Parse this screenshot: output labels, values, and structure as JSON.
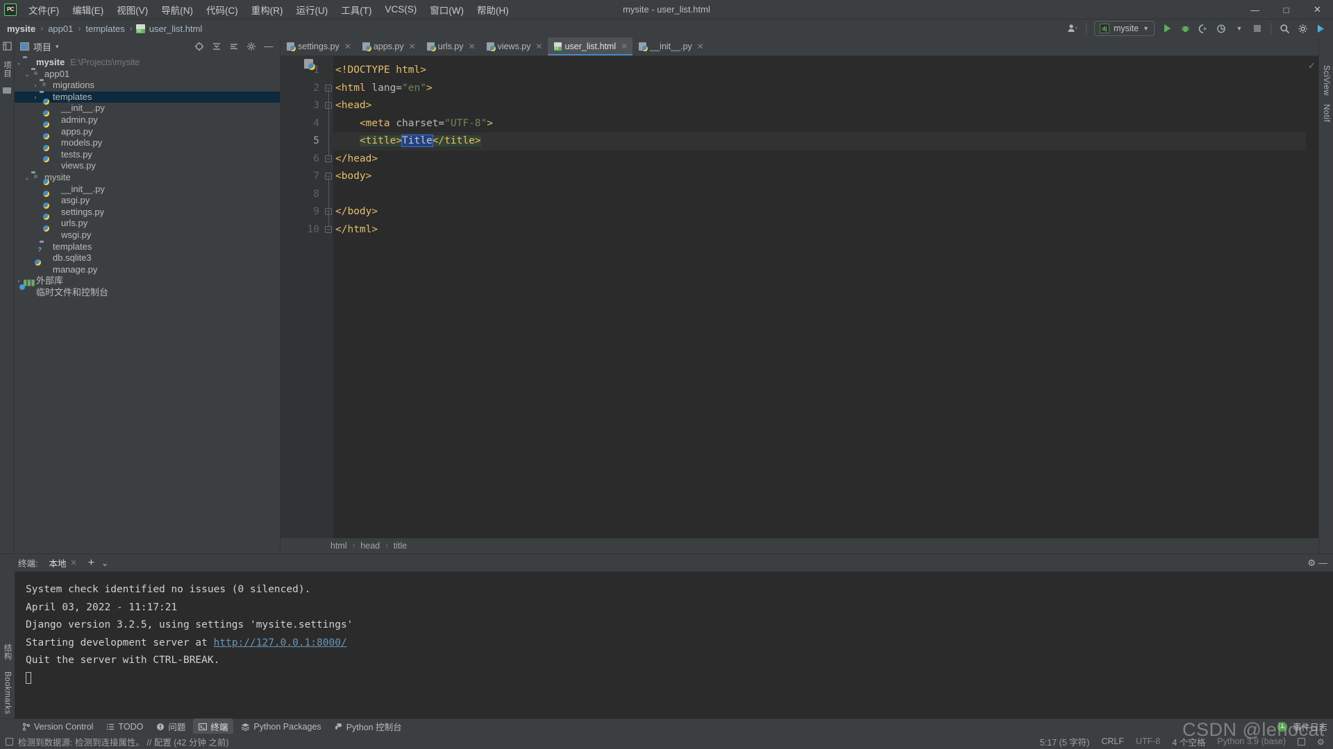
{
  "window": {
    "title": "mysite - user_list.html",
    "minimize": "—",
    "maximize": "□",
    "close": "✕",
    "logo": "PC"
  },
  "menu": {
    "items": [
      {
        "label": "文件(F)"
      },
      {
        "label": "编辑(E)"
      },
      {
        "label": "视图(V)"
      },
      {
        "label": "导航(N)"
      },
      {
        "label": "代码(C)"
      },
      {
        "label": "重构(R)"
      },
      {
        "label": "运行(U)"
      },
      {
        "label": "工具(T)"
      },
      {
        "label": "VCS(S)"
      },
      {
        "label": "窗口(W)"
      },
      {
        "label": "帮助(H)"
      }
    ]
  },
  "breadcrumb": {
    "items": [
      "mysite",
      "app01",
      "templates",
      "user_list.html"
    ],
    "separator": "›"
  },
  "toolbar": {
    "run_config": "mysite",
    "dj_badge": "dj",
    "run_title": "运行",
    "debug_title": "调试",
    "coverage_title": "覆盖率",
    "profile_title": "性能分析",
    "stop_title": "停止",
    "search_title": "搜索",
    "settings_title": "设置",
    "updates_title": "更新"
  },
  "project_panel": {
    "title": "项目",
    "caret": "▾",
    "tree": [
      {
        "depth": 0,
        "arrow": "⌄",
        "icon": "folder",
        "label": "mysite",
        "bold": true,
        "path": "E:\\Projects\\mysite",
        "selected": false
      },
      {
        "depth": 1,
        "arrow": "⌄",
        "icon": "folder-module",
        "label": "app01",
        "bold": false,
        "path": "",
        "selected": false
      },
      {
        "depth": 2,
        "arrow": "›",
        "icon": "folder-module",
        "label": "migrations",
        "bold": false,
        "path": "",
        "selected": false
      },
      {
        "depth": 2,
        "arrow": "›",
        "icon": "folder",
        "label": "templates",
        "bold": false,
        "path": "",
        "selected": true
      },
      {
        "depth": 3,
        "arrow": "",
        "icon": "python",
        "label": "__init__.py",
        "bold": false,
        "path": "",
        "selected": false
      },
      {
        "depth": 3,
        "arrow": "",
        "icon": "python",
        "label": "admin.py",
        "bold": false,
        "path": "",
        "selected": false
      },
      {
        "depth": 3,
        "arrow": "",
        "icon": "python",
        "label": "apps.py",
        "bold": false,
        "path": "",
        "selected": false
      },
      {
        "depth": 3,
        "arrow": "",
        "icon": "python",
        "label": "models.py",
        "bold": false,
        "path": "",
        "selected": false
      },
      {
        "depth": 3,
        "arrow": "",
        "icon": "python",
        "label": "tests.py",
        "bold": false,
        "path": "",
        "selected": false
      },
      {
        "depth": 3,
        "arrow": "",
        "icon": "python",
        "label": "views.py",
        "bold": false,
        "path": "",
        "selected": false
      },
      {
        "depth": 1,
        "arrow": "⌄",
        "icon": "folder-module",
        "label": "mysite",
        "bold": false,
        "path": "",
        "selected": false
      },
      {
        "depth": 3,
        "arrow": "",
        "icon": "python",
        "label": "__init__.py",
        "bold": false,
        "path": "",
        "selected": false
      },
      {
        "depth": 3,
        "arrow": "",
        "icon": "python",
        "label": "asgi.py",
        "bold": false,
        "path": "",
        "selected": false
      },
      {
        "depth": 3,
        "arrow": "",
        "icon": "python",
        "label": "settings.py",
        "bold": false,
        "path": "",
        "selected": false
      },
      {
        "depth": 3,
        "arrow": "",
        "icon": "python",
        "label": "urls.py",
        "bold": false,
        "path": "",
        "selected": false
      },
      {
        "depth": 3,
        "arrow": "",
        "icon": "python",
        "label": "wsgi.py",
        "bold": false,
        "path": "",
        "selected": false
      },
      {
        "depth": 2,
        "arrow": "",
        "icon": "folder-purple",
        "label": "templates",
        "bold": false,
        "path": "",
        "selected": false
      },
      {
        "depth": 2,
        "arrow": "",
        "icon": "db",
        "label": "db.sqlite3",
        "bold": false,
        "path": "",
        "selected": false
      },
      {
        "depth": 2,
        "arrow": "",
        "icon": "python",
        "label": "manage.py",
        "bold": false,
        "path": "",
        "selected": false
      },
      {
        "depth": 0,
        "arrow": "›",
        "icon": "library",
        "label": "外部库",
        "bold": false,
        "path": "",
        "selected": false
      },
      {
        "depth": 0,
        "arrow": "",
        "icon": "scratch",
        "label": "临时文件和控制台",
        "bold": false,
        "path": "",
        "selected": false
      }
    ]
  },
  "left_strip": {
    "items": [
      "项目",
      "收藏"
    ]
  },
  "right_strip": {
    "items": [
      "SciView",
      "Notif"
    ]
  },
  "editor": {
    "tabs": [
      {
        "label": "settings.py",
        "icon": "python",
        "active": false
      },
      {
        "label": "apps.py",
        "icon": "python",
        "active": false
      },
      {
        "label": "urls.py",
        "icon": "python",
        "active": false
      },
      {
        "label": "views.py",
        "icon": "python",
        "active": false
      },
      {
        "label": "user_list.html",
        "icon": "html",
        "active": true
      },
      {
        "label": "__init__.py",
        "icon": "python",
        "active": false
      }
    ],
    "close_glyph": "✕",
    "lines": [
      {
        "num": "1",
        "fold": "",
        "current": false,
        "tokens": [
          {
            "t": "<!DOCTYPE html>",
            "c": "tg"
          }
        ]
      },
      {
        "num": "2",
        "fold": "minus-down",
        "current": false,
        "tokens": [
          {
            "t": "<html ",
            "c": "tg"
          },
          {
            "t": "lang=",
            "c": "at"
          },
          {
            "t": "\"en\"",
            "c": "vl"
          },
          {
            "t": ">",
            "c": "tg"
          }
        ]
      },
      {
        "num": "3",
        "fold": "minus-down",
        "current": false,
        "tokens": [
          {
            "t": "<head>",
            "c": "tg"
          }
        ]
      },
      {
        "num": "4",
        "fold": "",
        "current": false,
        "tokens": [
          {
            "t": "    <meta ",
            "c": "tg"
          },
          {
            "t": "charset=",
            "c": "at"
          },
          {
            "t": "\"UTF-8\"",
            "c": "vl"
          },
          {
            "t": ">",
            "c": "tg"
          }
        ]
      },
      {
        "num": "5",
        "fold": "",
        "current": true,
        "tokens": [
          {
            "t": "    ",
            "c": "pl"
          },
          {
            "t": "<title>",
            "c": "tg hl"
          },
          {
            "t": "Title",
            "c": "selbox"
          },
          {
            "t": "</title>",
            "c": "tg hl"
          }
        ]
      },
      {
        "num": "6",
        "fold": "minus-up",
        "current": false,
        "tokens": [
          {
            "t": "</head>",
            "c": "tg"
          }
        ]
      },
      {
        "num": "7",
        "fold": "minus-down",
        "current": false,
        "tokens": [
          {
            "t": "<body>",
            "c": "tg"
          }
        ]
      },
      {
        "num": "8",
        "fold": "",
        "current": false,
        "tokens": []
      },
      {
        "num": "9",
        "fold": "minus-up",
        "current": false,
        "tokens": [
          {
            "t": "</body>",
            "c": "tg"
          }
        ]
      },
      {
        "num": "10",
        "fold": "minus-up",
        "current": false,
        "tokens": [
          {
            "t": "</html>",
            "c": "tg"
          }
        ]
      }
    ],
    "inspection_status": "✓",
    "structure_breadcrumb": [
      "html",
      "head",
      "title"
    ],
    "crumb_sep": "›"
  },
  "terminal": {
    "label": "终端:",
    "tab": "本地",
    "close_glyph": "✕",
    "add_glyph": "+",
    "dropdown_glyph": "⌄",
    "settings_glyph": "⚙",
    "minimize_glyph": "—",
    "lines": [
      {
        "text": "System check identified no issues (0 silenced).",
        "link": ""
      },
      {
        "text": "April 03, 2022 - 11:17:21",
        "link": ""
      },
      {
        "text": "Django version 3.2.5, using settings 'mysite.settings'",
        "link": ""
      },
      {
        "text": "Starting development server at ",
        "link": "http://127.0.0.1:8000/"
      },
      {
        "text": "Quit the server with CTRL-BREAK.",
        "link": ""
      }
    ],
    "side_labels": [
      "Bookmarks",
      "结构"
    ]
  },
  "toolwindow_bar": {
    "items": [
      {
        "label": "Version Control",
        "icon": "branch-icon",
        "active": false
      },
      {
        "label": "TODO",
        "icon": "list-icon",
        "active": false
      },
      {
        "label": "问题",
        "icon": "warning-icon",
        "active": false
      },
      {
        "label": "终端",
        "icon": "terminal-icon",
        "active": true
      },
      {
        "label": "Python Packages",
        "icon": "packages-icon",
        "active": false
      },
      {
        "label": "Python 控制台",
        "icon": "python-icon",
        "active": false
      }
    ],
    "event_log": "事件日志",
    "event_count": "1"
  },
  "statusbar": {
    "message": "检测到数据源: 检测到连接属性。  // 配置 (42 分钟 之前)",
    "caret_position": "5:17 (5 字符)",
    "line_separator": "CRLF",
    "encoding": "UTF-8",
    "indent": "4 个空格",
    "interpreter": "Python 3.9 (base)"
  },
  "watermark": {
    "text": "CSDN @lehocat"
  },
  "colors": {
    "accent_blue": "#4a88c7",
    "selection_bg": "#0d293e",
    "tag_orange": "#e8bf6a",
    "value_green": "#6a8759",
    "link_blue": "#6897bb",
    "panel_bg": "#3c3f41",
    "editor_bg": "#2b2b2b"
  }
}
